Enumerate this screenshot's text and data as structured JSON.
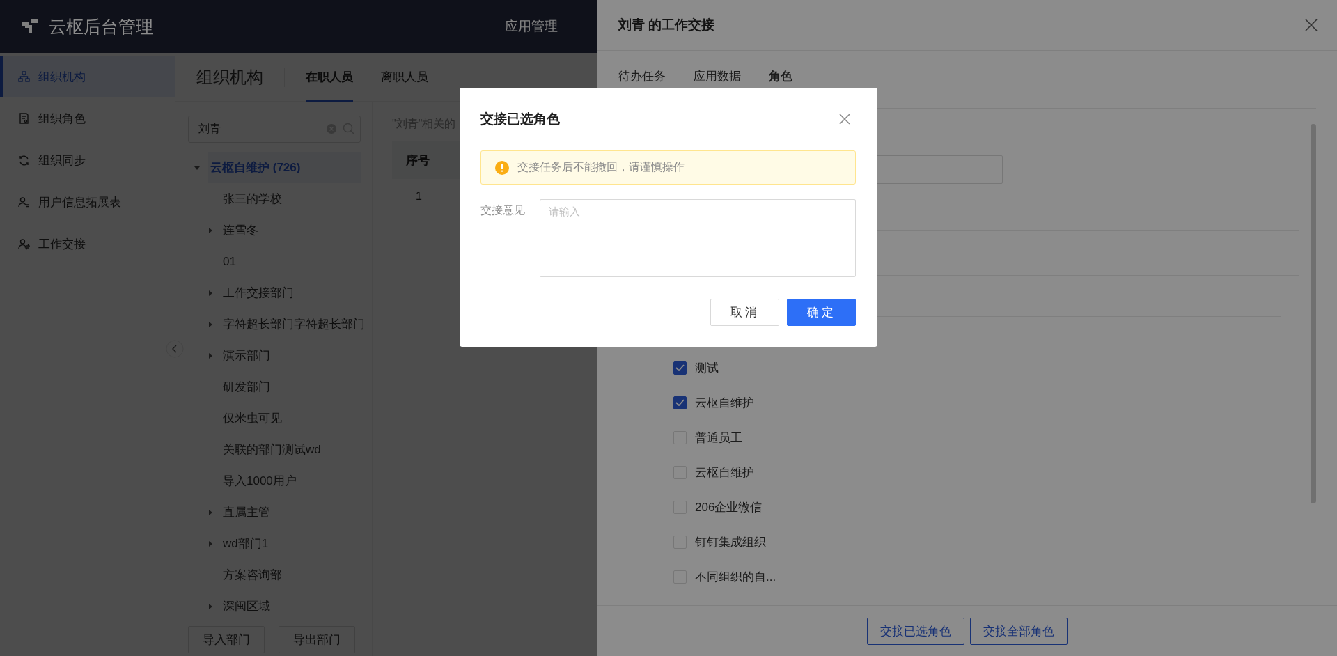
{
  "top_bar": {
    "title": "云枢后台管理",
    "nav": [
      {
        "label": "应用管理"
      }
    ]
  },
  "sidebar": {
    "items": [
      {
        "label": "组织机构",
        "selected": true
      },
      {
        "label": "组织角色",
        "selected": false
      },
      {
        "label": "组织同步",
        "selected": false
      },
      {
        "label": "用户信息拓展表",
        "selected": false
      },
      {
        "label": "工作交接",
        "selected": false
      }
    ]
  },
  "page": {
    "title": "组织机构",
    "tabs": [
      {
        "label": "在职人员",
        "selected": true
      },
      {
        "label": "离职人员",
        "selected": false
      }
    ]
  },
  "tree": {
    "search": {
      "value": "刘青"
    },
    "root": {
      "label": "云枢自维护",
      "count": "(726)",
      "expanded": true,
      "selected": true,
      "children": [
        {
          "label": "张三的学校",
          "kind": "leaf"
        },
        {
          "label": "连雪冬",
          "kind": "branch"
        },
        {
          "label": "01",
          "kind": "leaf"
        },
        {
          "label": "工作交接部门",
          "kind": "branch"
        },
        {
          "label": "字符超长部门字符超长部门",
          "kind": "branch"
        },
        {
          "label": "演示部门",
          "kind": "branch"
        },
        {
          "label": "研发部门",
          "kind": "leaf"
        },
        {
          "label": "仅米虫可见",
          "kind": "leaf"
        },
        {
          "label": "关联的部门测试wd",
          "kind": "leaf"
        },
        {
          "label": "导入1000用户",
          "kind": "leaf"
        },
        {
          "label": "直属主管",
          "kind": "branch"
        },
        {
          "label": "wd部门1",
          "kind": "branch"
        },
        {
          "label": "方案咨询部",
          "kind": "leaf"
        },
        {
          "label": "深闽区域",
          "kind": "branch"
        }
      ]
    },
    "buttons": [
      "导入部门",
      "导出部门"
    ]
  },
  "results": {
    "caption": "\"刘青\"相关的",
    "columns": [
      "序号"
    ],
    "rows": [
      [
        "1"
      ]
    ]
  },
  "drawer": {
    "title": "刘青 的工作交接",
    "tabs": [
      {
        "label": "待办任务",
        "selected": false
      },
      {
        "label": "应用数据",
        "selected": false
      },
      {
        "label": "角色",
        "selected": true
      }
    ],
    "roles": [
      {
        "label": "测试",
        "checked": true
      },
      {
        "label": "云枢自维护",
        "checked": true
      },
      {
        "label": "普通员工",
        "checked": false
      },
      {
        "label": "云枢自维护",
        "checked": false
      },
      {
        "label": "206企业微信",
        "checked": false
      },
      {
        "label": "钉钉集成组织",
        "checked": false
      },
      {
        "label": "不同组织的自...",
        "checked": false
      }
    ],
    "footer_buttons": [
      "交接已选角色",
      "交接全部角色"
    ]
  },
  "dialog": {
    "title": "交接已选角色",
    "alert": "交接任务后不能撤回，请谨慎操作",
    "field": {
      "label": "交接意见",
      "placeholder": "请输入"
    },
    "buttons": [
      {
        "label": "取消",
        "kind": "default"
      },
      {
        "label": "确定",
        "kind": "primary"
      }
    ]
  }
}
